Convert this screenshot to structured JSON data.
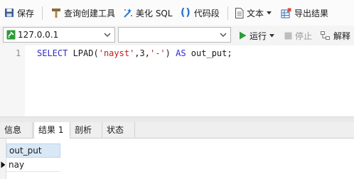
{
  "toolbar": {
    "save": "保存",
    "query_builder": "查询创建工具",
    "beautify_sql": "美化 SQL",
    "code_snippet": "代码段",
    "text": "文本",
    "export_results": "导出结果"
  },
  "toolbar2": {
    "connection": "127.0.0.1",
    "database": "",
    "run": "运行",
    "stop": "停止",
    "explain": "解释"
  },
  "editor": {
    "line_number": "1",
    "tokens": {
      "kw_select": "SELECT",
      "fn": " LPAD(",
      "arg1": "'nayst'",
      "arg2": ",3,",
      "arg3": "'-'",
      "close": ") ",
      "kw_as": "AS",
      "alias": " out_put;"
    }
  },
  "result_tabs": [
    "信息",
    "结果 1",
    "剖析",
    "状态"
  ],
  "grid": {
    "columns": [
      "out_put"
    ],
    "rows": [
      [
        "nay"
      ]
    ]
  },
  "colors": {
    "accent_green": "#2e9a3a",
    "keyword_blue": "#2c2cc8",
    "string_red": "#c31a1a",
    "header_blue": "#d9e8f7"
  }
}
